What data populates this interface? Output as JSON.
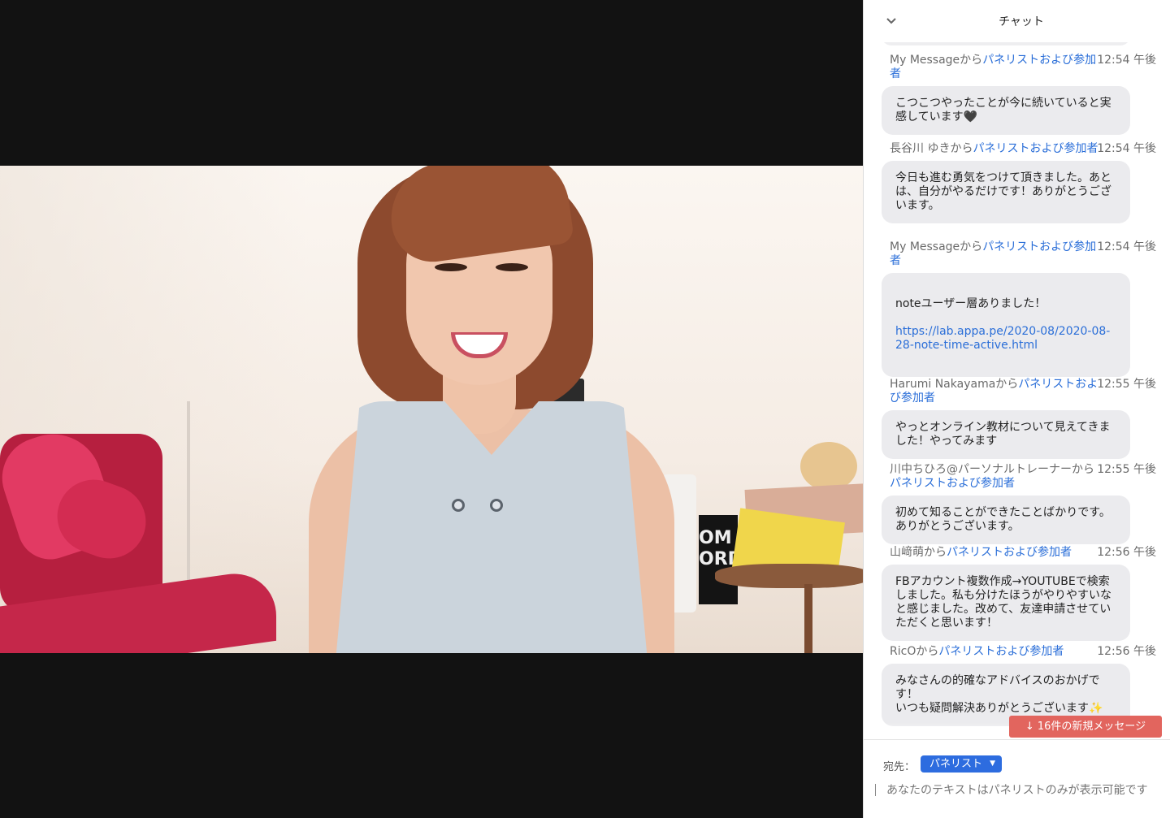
{
  "chat": {
    "title": "チャット",
    "messages": [
      {
        "sender": "My Messageから",
        "to": "パネリストおよび参加者",
        "time": "12:54 午後",
        "text": "こつこつやったことが今に続いていると実感しています🖤"
      },
      {
        "sender": "長谷川 ゆきから",
        "to": "パネリストおよび参加者",
        "time": "12:54 午後",
        "text": "今日も進む勇気をつけて頂きました。あとは、自分がやるだけです！ありがとうございます。"
      },
      {
        "sender": "My Messageから",
        "to": "パネリストおよび参加者",
        "time": "12:54 午後",
        "text": "noteユーザー層ありました！",
        "link": "https://lab.appa.pe/2020-08/2020-08-28-note-time-active.html"
      },
      {
        "sender": "Harumi Nakayamaから",
        "to": "パネリストおよび参加者",
        "time": "12:55 午後",
        "text": "やっとオンライン教材について見えてきました！やってみます"
      },
      {
        "sender": "川中ちひろ@パーソナルトレーナーから",
        "to": "パネリストおよび参加者",
        "time": "12:55 午後",
        "text": "初めて知ることができたことばかりです。ありがとうございます。"
      },
      {
        "sender": "山﨑萌から",
        "to": "パネリストおよび参加者",
        "time": "12:56 午後",
        "text": "FBアカウント複数作成→YOUTUBEで検索しました。私も分けたほうがやりやすいなと感じました。改めて、友達申請させていただくと思います！"
      },
      {
        "sender": "RicOから",
        "to": "パネリストおよび参加者",
        "time": "12:56 午後",
        "text": "みなさんの的確なアドバイスのおかげです！\nいつも疑問解決ありがとうございます✨"
      }
    ],
    "new_messages_button": "16件の新規メッセージ",
    "to_label": "宛先：",
    "to_value": "パネリスト",
    "input_placeholder": "あなたのテキストはパネリストのみが表示可能です"
  },
  "video": {
    "sign_text": "OM\nORD"
  }
}
